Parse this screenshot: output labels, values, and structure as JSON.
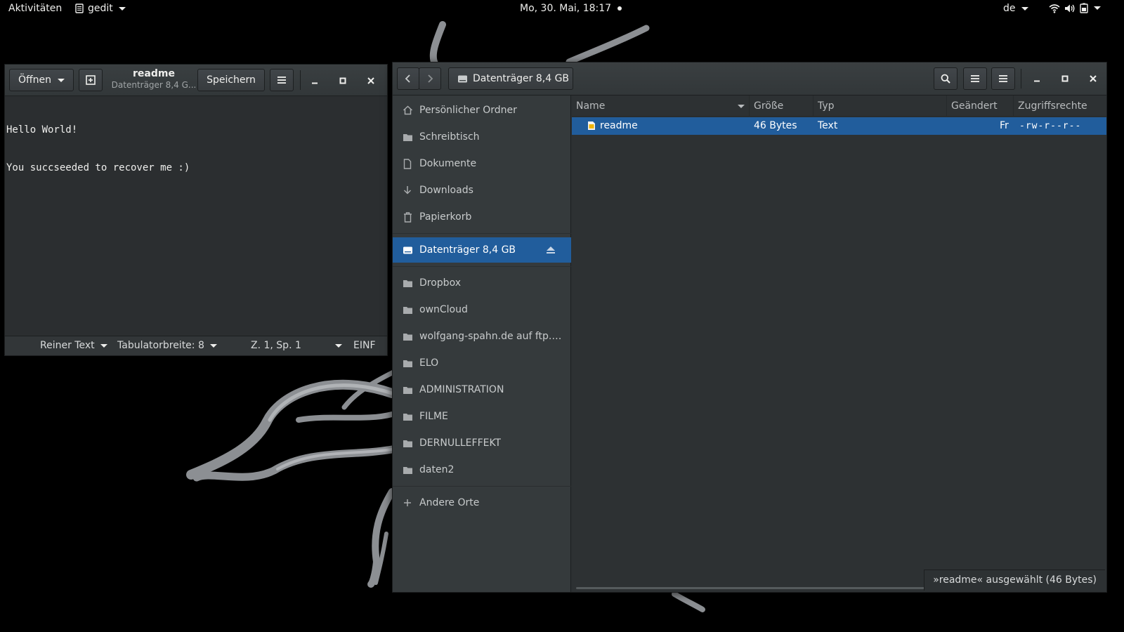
{
  "topbar": {
    "activities": "Aktivitäten",
    "app_name": "gedit",
    "clock": "Mo, 30. Mai, 18:17",
    "language": "de"
  },
  "gedit": {
    "open_label": "Öffnen",
    "title": "readme",
    "subtitle": "Datenträger 8,4 G...",
    "save_label": "Speichern",
    "content_lines": [
      "Hello World!",
      "You succseeded to recover me :)"
    ],
    "status": {
      "syntax": "Reiner Text",
      "tab_width": "Tabulatorbreite: 8",
      "position": "Z. 1, Sp. 1",
      "mode": "EINF"
    }
  },
  "files": {
    "location": "Datenträger 8,4 GB",
    "sidebar": {
      "places": [
        "Persönlicher Ordner",
        "Schreibtisch",
        "Dokumente",
        "Downloads",
        "Papierkorb"
      ],
      "device": "Datenträger 8,4 GB",
      "bookmarks": [
        "Dropbox",
        "ownCloud",
        "wolfgang-spahn.de auf ftp.str...",
        "ELO",
        "ADMINISTRATION",
        "FILME",
        "DERNULLEFFEKT",
        "daten2"
      ],
      "other": "Andere Orte"
    },
    "columns": {
      "name": "Name",
      "size": "Größe",
      "type": "Typ",
      "modified": "Geändert",
      "permissions": "Zugriffsrechte"
    },
    "rows": [
      {
        "name": "readme",
        "size": "46 Bytes",
        "type": "Text",
        "modified": "Fr",
        "permissions": "-rw-r--r--"
      }
    ],
    "status": "»readme« ausgewählt  (46 Bytes)"
  },
  "colors": {
    "selection": "#215d9c",
    "window_bg": "#2d3133",
    "headerbar": "#3a3f41"
  }
}
